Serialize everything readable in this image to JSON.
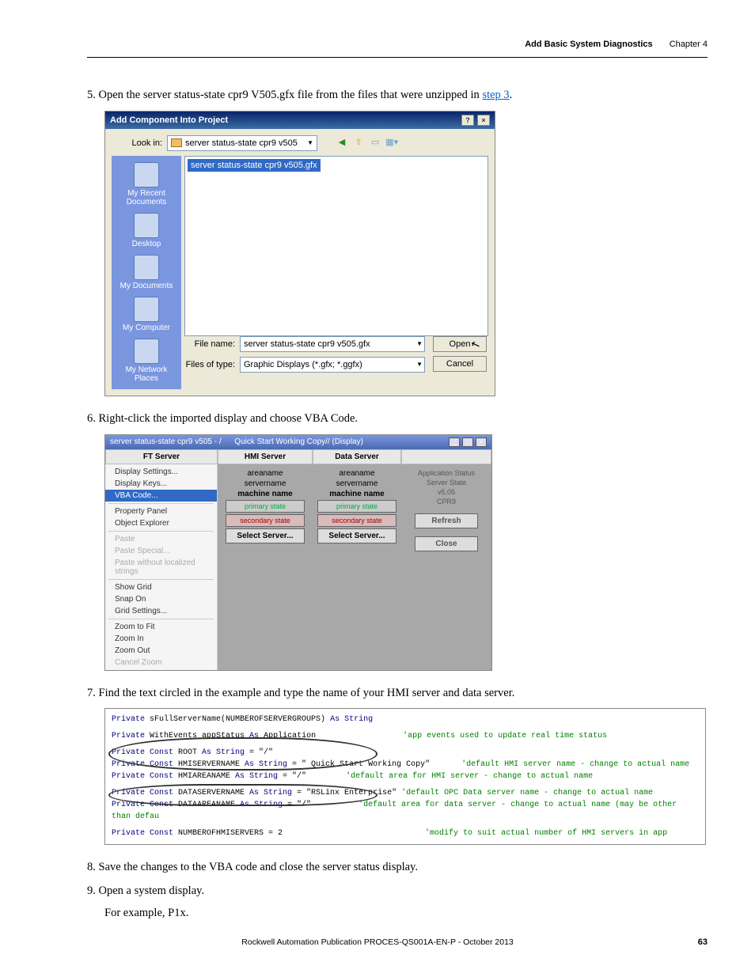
{
  "header": {
    "title": "Add Basic System Diagnostics",
    "chapter": "Chapter 4"
  },
  "step5": {
    "num": "5.",
    "text_a": "Open the server status-state cpr9 V505.gfx file from the files that were unzipped in ",
    "link": "step 3",
    "text_b": "."
  },
  "dlg1": {
    "title": "Add Component Into Project",
    "lookin_label": "Look in:",
    "lookin_value": "server status-state cpr9 v505",
    "file_selected": "server status-state cpr9 v505.gfx",
    "sidebar": {
      "recent": "My Recent Documents",
      "desktop": "Desktop",
      "mydocs": "My Documents",
      "mycomp": "My Computer",
      "netplaces": "My Network Places"
    },
    "filename_label": "File name:",
    "filename_value": "server status-state cpr9 v505.gfx",
    "filestype_label": "Files of type:",
    "filestype_value": "Graphic Displays (*.gfx; *.ggfx)",
    "open_btn": "Open",
    "cancel_btn": "Cancel"
  },
  "step6": {
    "num": "6.",
    "text": "Right-click the imported display and choose VBA Code."
  },
  "dlg2": {
    "title_a": "server status-state cpr9 v505 - /",
    "title_b": "Quick Start Working Copy// (Display)",
    "cols": {
      "ft": "FT Server",
      "hmi": "HMI Server",
      "data": "Data Server"
    },
    "ctx": {
      "disp_set": "Display Settings...",
      "disp_keys": "Display Keys...",
      "vba": "VBA Code...",
      "prop": "Property Panel",
      "obj": "Object Explorer",
      "paste": "Paste",
      "paste_sp": "Paste Special...",
      "paste_wo": "Paste without localized strings",
      "showgrid": "Show Grid",
      "snapon": "Snap On",
      "gridset": "Grid Settings...",
      "zoomfit": "Zoom to Fit",
      "zoomin": "Zoom In",
      "zoomout": "Zoom Out",
      "cancelz": "Cancel Zoom"
    },
    "srv": {
      "area": "areaname",
      "server": "servername",
      "machine": "machine name",
      "primary": "primary state",
      "secondary": "secondary state",
      "select": "Select Server..."
    },
    "app": {
      "l1": "Application Status",
      "l2": "Server State",
      "l3": "v5.05",
      "l4": "CPR9",
      "refresh": "Refresh",
      "close": "Close"
    }
  },
  "step7": {
    "num": "7.",
    "text": "Find the text circled in the example and type the name of your HMI server and data server."
  },
  "vba": {
    "l1a": "Private",
    "l1b": " sFullServerName(NUMBEROFSERVERGROUPS) ",
    "l1c": "As String",
    "l2a": "Private",
    "l2b": " WithEvents appStatus ",
    "l2c": "As",
    "l2d": " Application",
    "l2cm": "'app events used to update real time status",
    "l3a": "Private Const",
    "l3b": " ROOT ",
    "l3c": "As String",
    "l3d": " = \"/\"",
    "l4a": "Private Const",
    "l4b": " HMISERVERNAME ",
    "l4c": "As String",
    "l4d": " = \"     Quick Start Working Copy\"",
    "l4cm": "'default HMI server name - change to actual name",
    "l5a": "Private Const",
    "l5b": " HMIAREANAME ",
    "l5c": "As String",
    "l5d": " = \"/\"",
    "l5cm": "'default area for HMI server - change to actual name",
    "l6a": "Private Const",
    "l6b": " DATASERVERNAME ",
    "l6c": "As String",
    "l6d": " = \"RSLinx Enterprise\"",
    "l6cm": " 'default OPC Data server name - change to actual name",
    "l7a": "Private Const",
    "l7b": " DATAAREANAME ",
    "l7c": "As String",
    "l7d": " = \"/\"",
    "l7cm": "'default area for data server - change to actual name (may be other than defau",
    "l8a": "Private Const",
    "l8b": " NUMBEROFHMISERVERS = 2",
    "l8cm": "'modify to suit actual number of HMI servers in app"
  },
  "step8": {
    "num": "8.",
    "text": "Save the changes to the VBA code and close the server status display."
  },
  "step9": {
    "num": "9.",
    "text": "Open a system display.",
    "sub": "For example, P1x."
  },
  "footer": "Rockwell Automation Publication PROCES-QS001A-EN-P - October 2013",
  "pagenum": "63"
}
